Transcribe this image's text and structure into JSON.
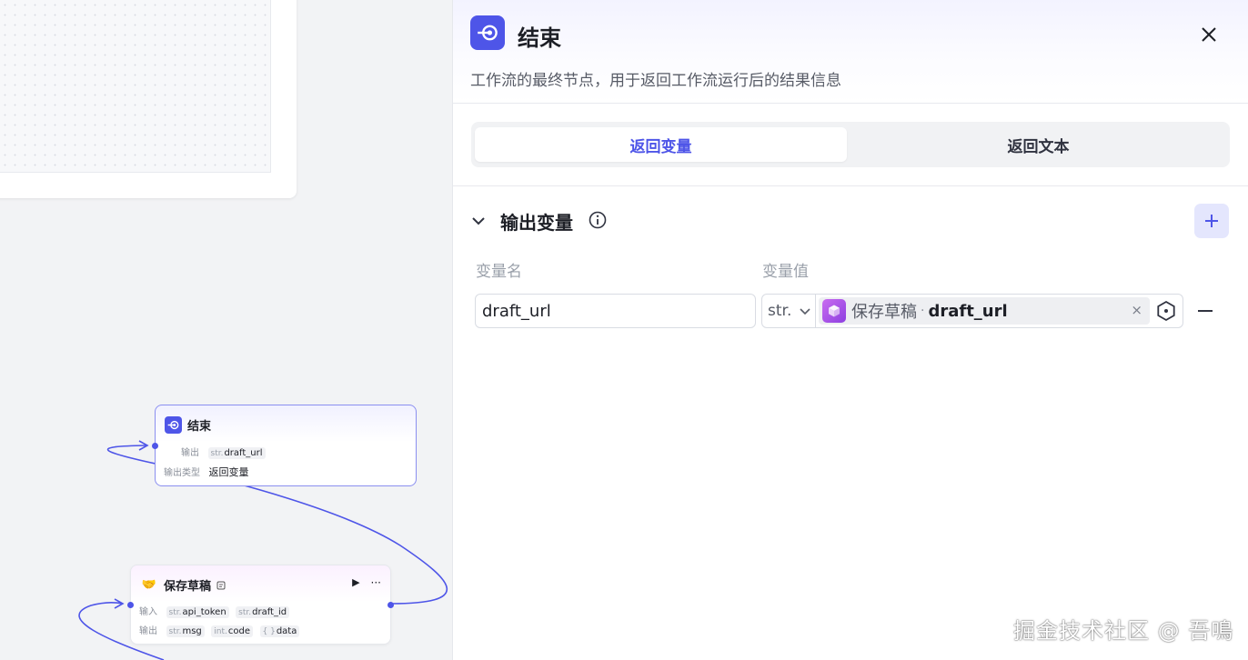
{
  "panel": {
    "title": "结束",
    "description": "工作流的最终节点，用于返回工作流运行后的结果信息",
    "tabs": [
      {
        "label": "返回变量",
        "active": true
      },
      {
        "label": "返回文本",
        "active": false
      }
    ],
    "section_title": "输出变量",
    "columns": {
      "name": "变量名",
      "value": "变量值"
    },
    "row": {
      "name_value": "draft_url",
      "type": "str.",
      "ref_node": "保存草稿",
      "ref_separator": "·",
      "ref_var": "draft_url",
      "clear": "×"
    }
  },
  "canvas": {
    "end_node": {
      "title": "结束",
      "output_label": "输出",
      "output_type": "str.",
      "output_var": "draft_url",
      "output_kind_label": "输出类型",
      "output_kind_value": "返回变量"
    },
    "save_node": {
      "title": "保存草稿",
      "input_label": "输入",
      "inputs": [
        {
          "type": "str.",
          "name": "api_token"
        },
        {
          "type": "str.",
          "name": "draft_id"
        }
      ],
      "output_label": "输出",
      "outputs": [
        {
          "type": "str.",
          "name": "msg"
        },
        {
          "type": "int.",
          "name": "code"
        },
        {
          "type": "{ }",
          "name": "data"
        }
      ],
      "run_icon": "▶",
      "more_icon": "···"
    }
  },
  "watermark": "掘金技术社区 @ 吾鳴",
  "colors": {
    "accent": "#4e55e8",
    "edge": "#4e55e8",
    "ref_icon": "#a64ce8"
  }
}
